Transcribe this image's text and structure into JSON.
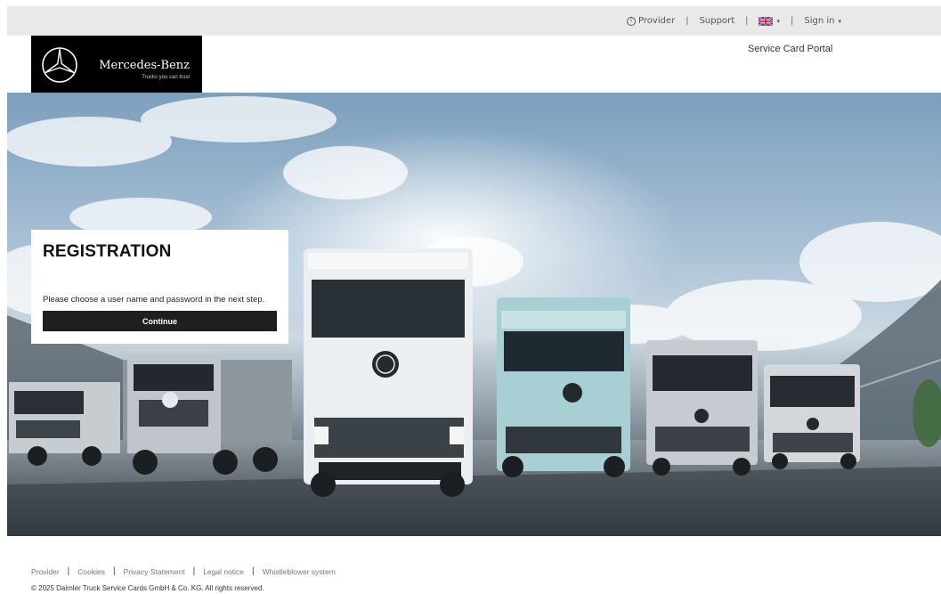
{
  "topbar": {
    "provider": "Provider",
    "support": "Support",
    "signin": "Sign in",
    "separator": "|"
  },
  "header": {
    "brand": "Mercedes-Benz",
    "tagline": "Trucks you can trust",
    "portal_title": "Service Card Portal"
  },
  "registration": {
    "title": "REGISTRATION",
    "text": "Please choose a user name and password in the next step.",
    "continue_label": "Continue"
  },
  "footer": {
    "links": [
      "Provider",
      "Cookies",
      "Privacy Statement",
      "Legal notice",
      "Whistleblower system"
    ],
    "separator": "|",
    "copyright": "© 2025 Daimler Truck Service Cards GmbH & Co. KG. All rights reserved."
  },
  "colors": {
    "topbar_bg": "#e9e9e9",
    "logo_bg": "#000000",
    "button_bg": "#1f1f1f"
  },
  "icons": {
    "provider": "info-icon",
    "language": "uk-flag-icon",
    "logo": "mercedes-star-icon"
  }
}
